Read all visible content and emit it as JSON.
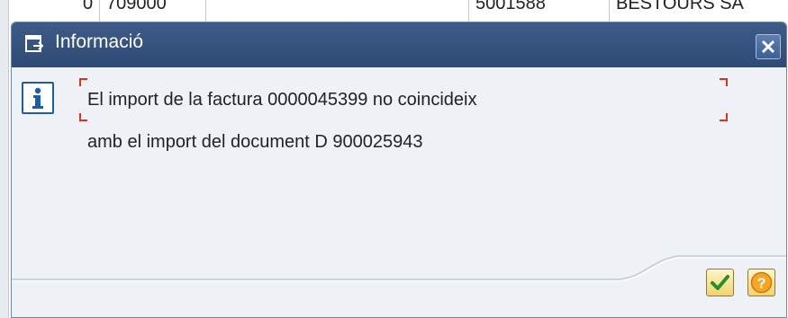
{
  "background_table": {
    "cells": [
      "0",
      "709000",
      "5001588",
      "BESTOURS SA"
    ]
  },
  "dialog": {
    "title": "Informació",
    "icons": {
      "title": "info-window-icon",
      "close": "close-icon",
      "message": "info-icon",
      "ok": "checkmark-icon",
      "help": "question-icon"
    },
    "message_line1": "El import de la factura 0000045399 no coincideix",
    "message_line2": "amb el import del document D 900025943"
  },
  "colors": {
    "titlebar": "#34517e",
    "dialog_bg": "#eef1f6",
    "focus_marker": "#e03020",
    "button_bg": "#f2d36b"
  }
}
